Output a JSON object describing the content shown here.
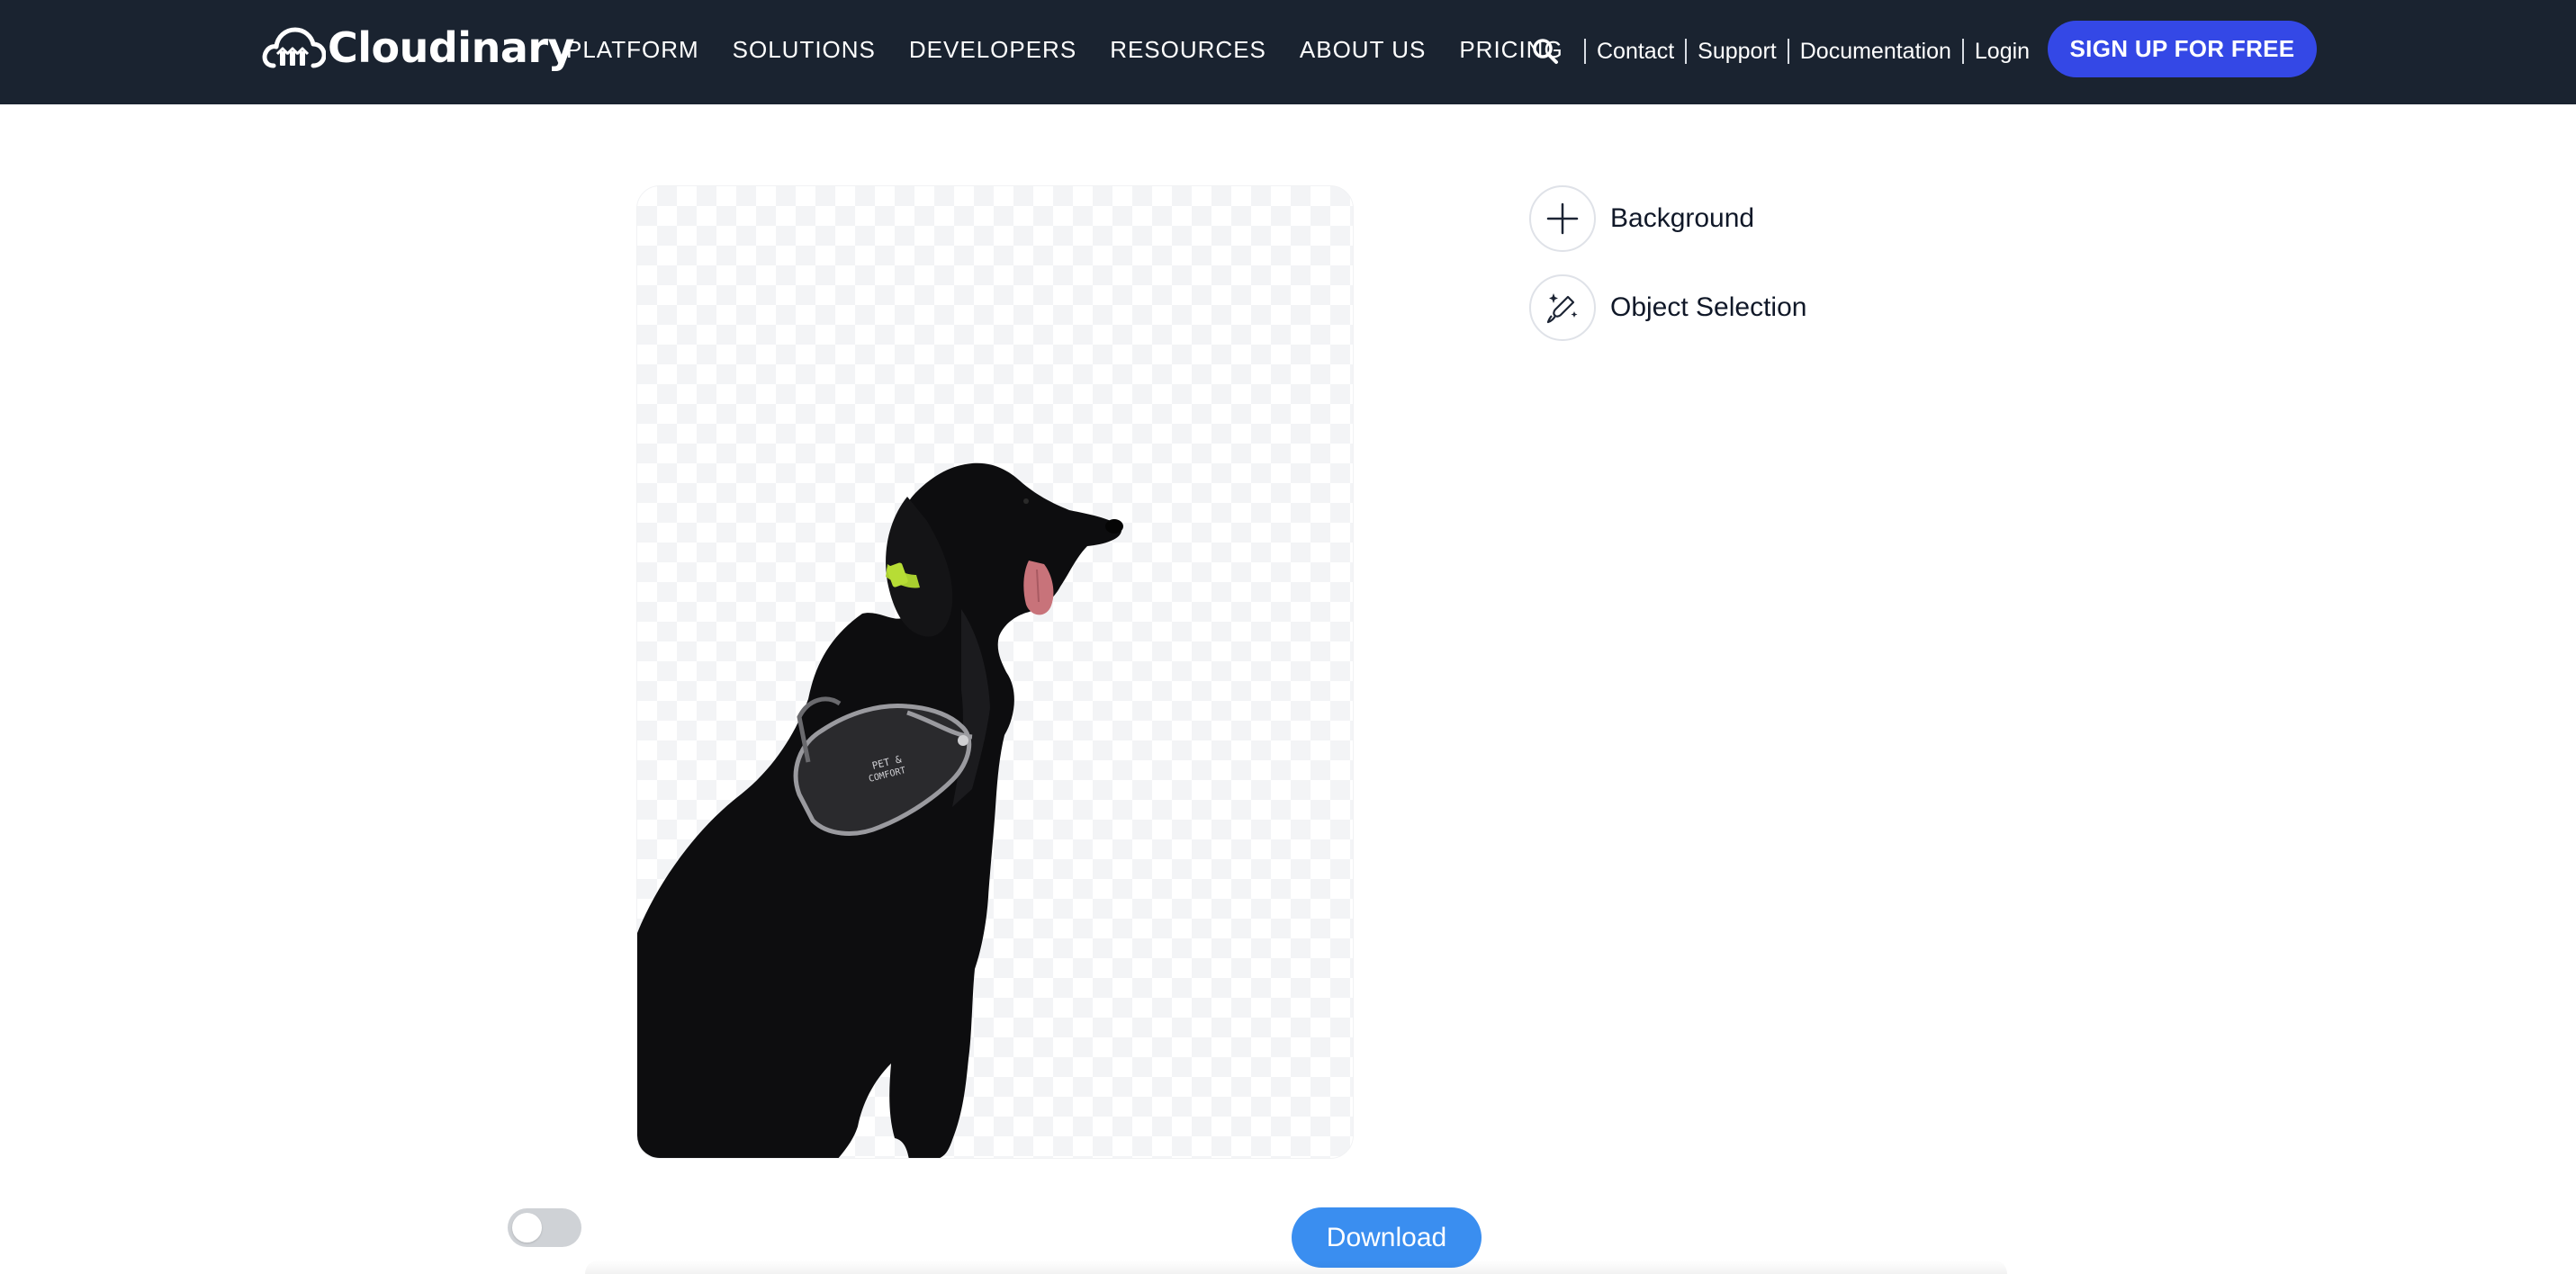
{
  "header": {
    "brand": "Cloudinary",
    "nav": [
      "PLATFORM",
      "SOLUTIONS",
      "DEVELOPERS",
      "RESOURCES",
      "ABOUT US",
      "PRICING"
    ],
    "links": {
      "contact": "Contact",
      "support": "Support",
      "documentation": "Documentation",
      "login": "Login"
    },
    "signup": "SIGN UP FOR FREE",
    "search_icon": "search-icon"
  },
  "preview": {
    "subject": "dog-cutout",
    "background": "transparent-checkerboard"
  },
  "tools": [
    {
      "icon": "plus-icon",
      "label": "Background"
    },
    {
      "icon": "magic-brush-icon",
      "label": "Object Selection"
    }
  ],
  "controls": {
    "toggle_on": false,
    "download": "Download"
  },
  "colors": {
    "header_bg": "#1a2330",
    "signup_bg": "#3448e6",
    "download_bg": "#3a8ef0",
    "toggle_off": "#cfd2d6"
  }
}
